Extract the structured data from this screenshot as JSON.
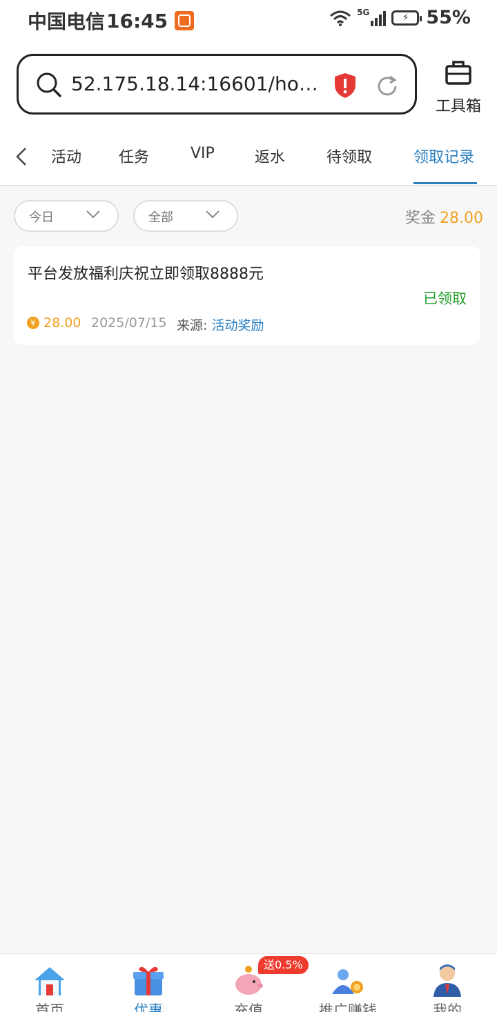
{
  "status_bar": {
    "carrier": "中国电信",
    "time": "16:45",
    "network": "5G",
    "battery": "55%"
  },
  "address_bar": {
    "url": "52.175.18.14:16601/hom..."
  },
  "toolbox": {
    "label": "工具箱"
  },
  "tabs": [
    {
      "label": "活动"
    },
    {
      "label": "任务"
    },
    {
      "label": "VIP"
    },
    {
      "label": "返水"
    },
    {
      "label": "待领取"
    },
    {
      "label": "领取记录",
      "active": true
    }
  ],
  "filters": {
    "date": "今日",
    "type": "全部"
  },
  "bonus": {
    "label": "奖金",
    "amount": "28.00"
  },
  "records": [
    {
      "title": "平台发放福利庆祝立即领取8888元",
      "status": "已领取",
      "coin_symbol": "¥",
      "amount": "28.00",
      "date": "2025/07/15",
      "source_label": "来源:",
      "source": "活动奖励"
    }
  ],
  "bottom_nav": [
    {
      "label": "首页",
      "icon": "house-icon"
    },
    {
      "label": "优惠",
      "icon": "gift-icon",
      "active": true
    },
    {
      "label": "充值",
      "icon": "piggy-bank-icon",
      "badge": "送0.5%"
    },
    {
      "label": "推广赚钱",
      "icon": "referral-icon"
    },
    {
      "label": "我的",
      "icon": "user-icon"
    }
  ],
  "colors": {
    "accent": "#2a7fc1",
    "gold": "#f0a020",
    "success": "#23a02a",
    "badge": "#ee3b2e"
  }
}
